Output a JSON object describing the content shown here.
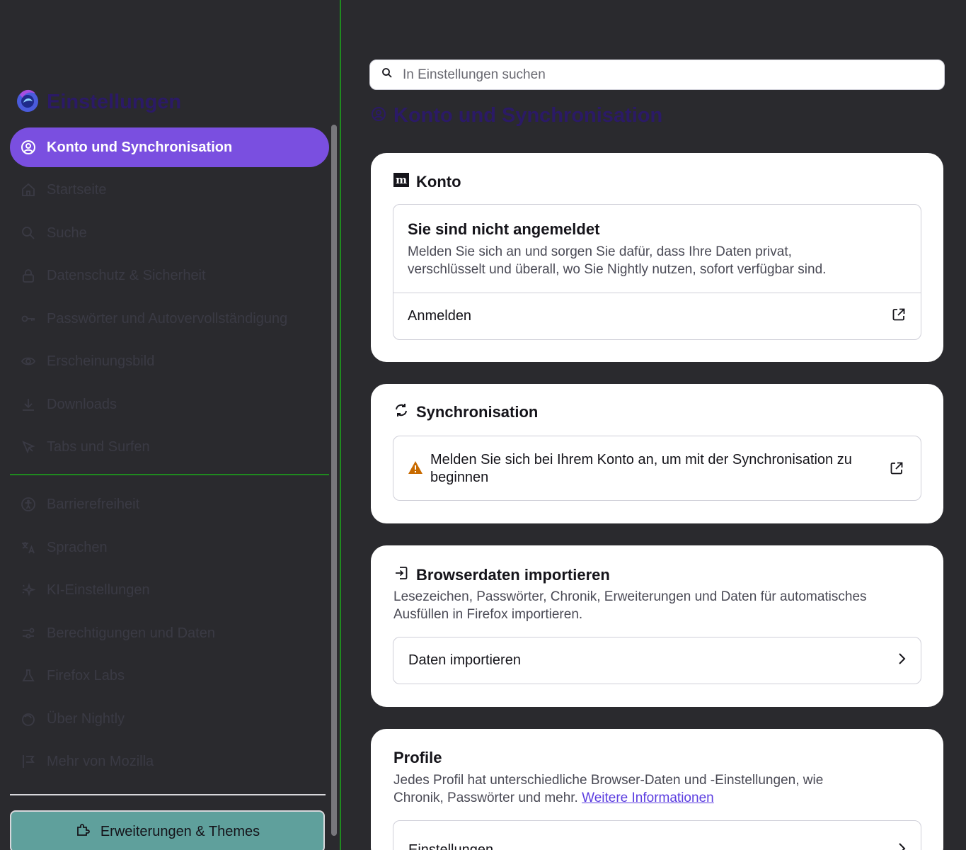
{
  "sidebar": {
    "title": "Einstellungen",
    "items": [
      {
        "label": "Konto und Synchronisation"
      },
      {
        "label": "Startseite"
      },
      {
        "label": "Suche"
      },
      {
        "label": "Datenschutz & Sicherheit"
      },
      {
        "label": "Passwörter und Autovervollständigung"
      },
      {
        "label": "Erscheinungsbild"
      },
      {
        "label": "Downloads"
      },
      {
        "label": "Tabs und Surfen"
      },
      {
        "label": "Barrierefreiheit"
      },
      {
        "label": "Sprachen"
      },
      {
        "label": "KI-Einstellungen"
      },
      {
        "label": "Berechtigungen und Daten"
      },
      {
        "label": "Firefox Labs"
      },
      {
        "label": "Über Nightly"
      },
      {
        "label": "Mehr von Mozilla"
      }
    ],
    "extensions_button": "Erweiterungen & Themes"
  },
  "search": {
    "placeholder": "In Einstellungen suchen"
  },
  "main": {
    "title": "Konto und Synchronisation",
    "account": {
      "heading": "Konto",
      "status_title": "Sie sind nicht angemeldet",
      "status_desc_1": "Melden Sie sich an und sorgen Sie dafür, dass Ihre Daten privat,",
      "status_desc_2": "verschlüsselt und überall, wo Sie Nightly nutzen, sofort verfügbar sind.",
      "sign_in": "Anmelden"
    },
    "sync": {
      "heading": "Synchronisation",
      "warning_1": "Melden Sie sich bei Ihrem Konto an, um mit der Synchronisation zu",
      "warning_2": "beginnen"
    },
    "import": {
      "heading": "Browserdaten importieren",
      "desc_1": "Lesezeichen, Passwörter, Chronik, Erweiterungen und Daten für automatisches",
      "desc_2": "Ausfüllen in Firefox importieren.",
      "button": "Daten importieren"
    },
    "profiles": {
      "heading": "Profile",
      "desc_1": "Jedes Profil hat unterschiedliche Browser-Daten und -Einstellungen, wie",
      "desc_2": "Chronik, Passwörter und mehr.",
      "link": "Weitere Informationen",
      "button": "Einstellungen"
    }
  },
  "colors": {
    "accent": "#7a4fe0",
    "title": "#2b1a66",
    "background": "#2a2a2e",
    "ext_button": "#5fa09c"
  }
}
